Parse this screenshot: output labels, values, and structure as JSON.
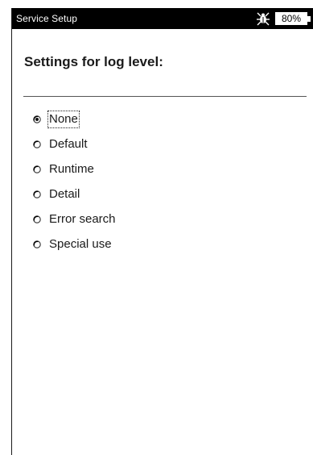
{
  "titlebar": {
    "title": "Service Setup",
    "battery_label": "80%",
    "battery_level": 0.8,
    "status_icon": "bug-icon"
  },
  "heading": "Settings for log level:",
  "selected_option": "None",
  "options": [
    {
      "label": "None"
    },
    {
      "label": "Default"
    },
    {
      "label": "Runtime"
    },
    {
      "label": "Detail"
    },
    {
      "label": "Error search"
    },
    {
      "label": "Special use"
    }
  ]
}
